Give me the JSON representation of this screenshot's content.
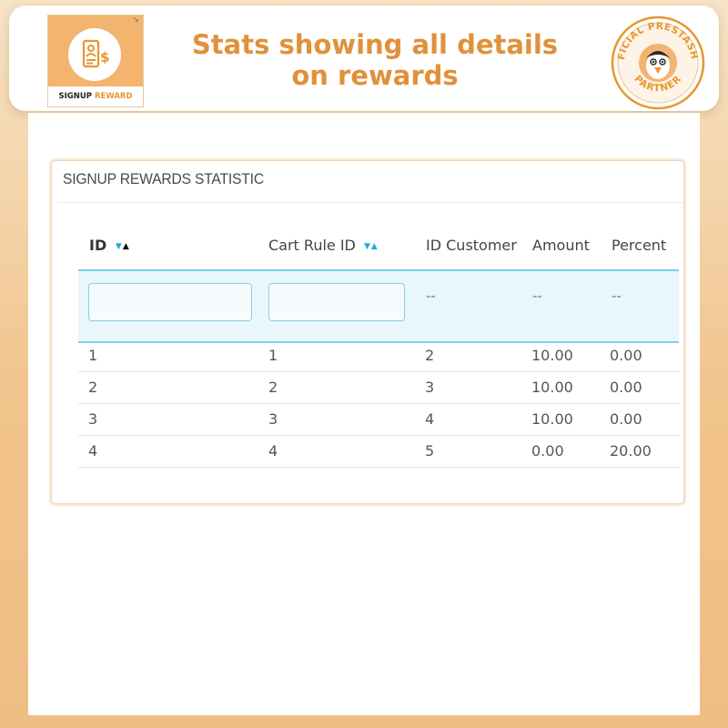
{
  "header": {
    "headline_line1": "Stats showing all details",
    "headline_line2": "on rewards",
    "logo": {
      "name_part1": "SIGNUP",
      "name_part2": "REWARD",
      "icon": "user-dollar-icon",
      "corner_glyph": "↘"
    },
    "badge": {
      "text_top": "OFFICIAL PRESTASHOP",
      "text_bottom": "PARTNER",
      "icon": "puffin-icon"
    }
  },
  "panel": {
    "title": "SIGNUP REWARDS STATISTIC"
  },
  "table": {
    "columns": [
      {
        "label": "ID",
        "sortable": true,
        "active_sort": "asc"
      },
      {
        "label": "Cart Rule ID",
        "sortable": true
      },
      {
        "label": "ID Customer",
        "sortable": false
      },
      {
        "label": "Amount",
        "sortable": false
      },
      {
        "label": "Percent",
        "sortable": false
      }
    ],
    "sort_desc_glyph": "▼",
    "sort_asc_glyph": "▲",
    "filters": {
      "id_value": "",
      "cart_rule_id_value": "",
      "placeholder": "--"
    },
    "rows": [
      {
        "id": "1",
        "cart_rule_id": "1",
        "id_customer": "2",
        "amount": "10.00",
        "percent": "0.00"
      },
      {
        "id": "2",
        "cart_rule_id": "2",
        "id_customer": "3",
        "amount": "10.00",
        "percent": "0.00"
      },
      {
        "id": "3",
        "cart_rule_id": "3",
        "id_customer": "4",
        "amount": "10.00",
        "percent": "0.00"
      },
      {
        "id": "4",
        "cart_rule_id": "4",
        "id_customer": "5",
        "amount": "0.00",
        "percent": "20.00"
      }
    ]
  },
  "colors": {
    "accent_orange": "#e0913a",
    "sort_blue": "#26a8df",
    "filter_border": "#7ccfea",
    "filter_bg": "#e9f6fb"
  }
}
